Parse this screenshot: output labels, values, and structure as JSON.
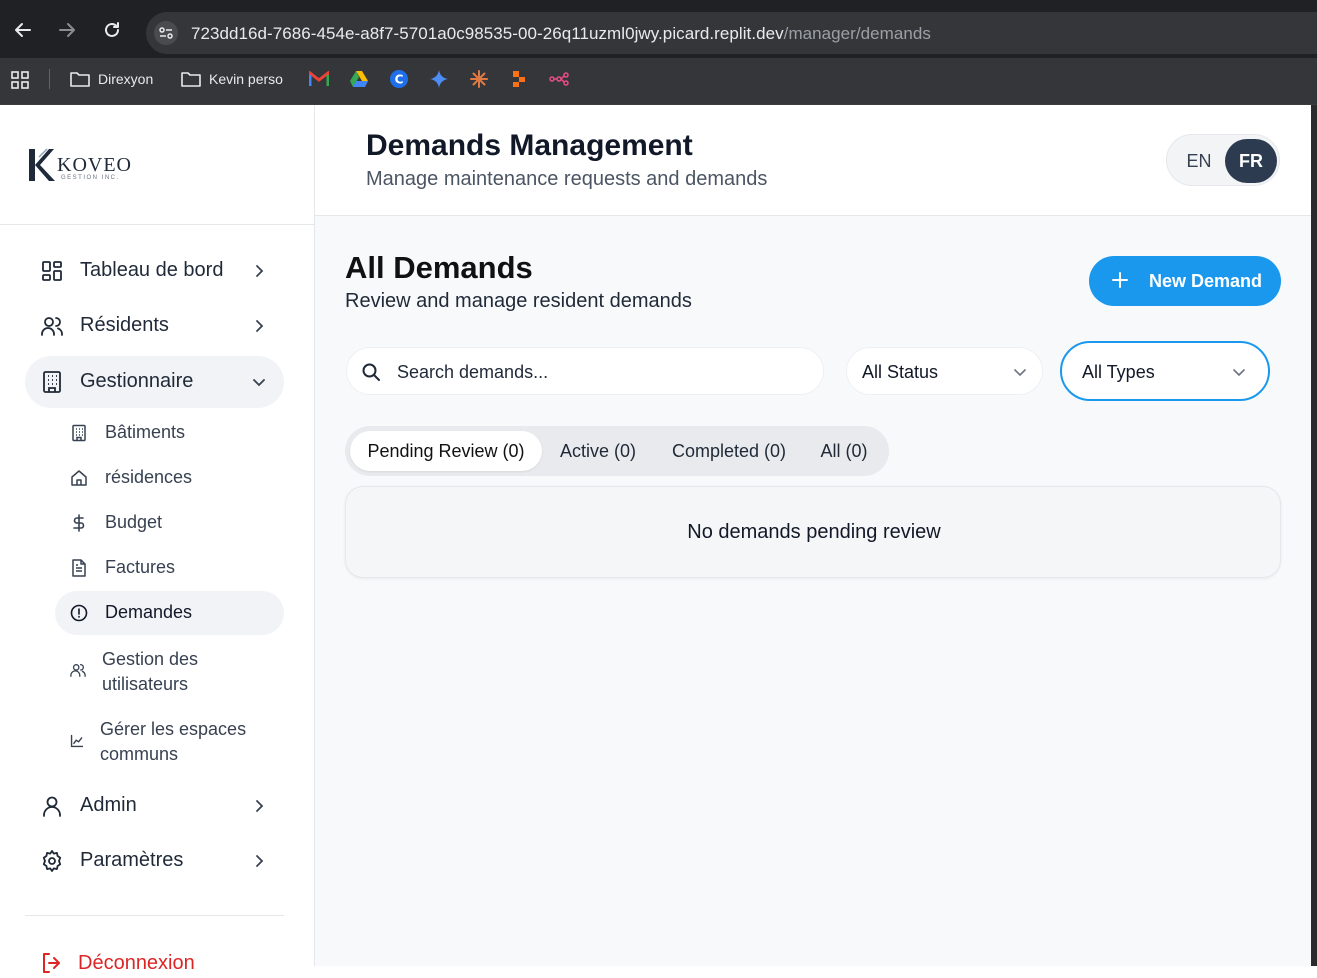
{
  "browser": {
    "url_host": "723dd16d-7686-454e-a8f7-5701a0c98535-00-26q11uzml0jwy.picard.replit.dev",
    "url_path": "/manager/demands",
    "bookmarks": [
      {
        "label": "Direxyon"
      },
      {
        "label": "Kevin perso"
      }
    ]
  },
  "logo": {
    "name": "KOVEO",
    "sub": "GESTION INC."
  },
  "sidebar": {
    "items": [
      {
        "label": "Tableau de bord"
      },
      {
        "label": "Résidents"
      },
      {
        "label": "Gestionnaire"
      },
      {
        "label": "Admin"
      },
      {
        "label": "Paramètres"
      }
    ],
    "subitems": [
      {
        "label": "Bâtiments"
      },
      {
        "label": "résidences"
      },
      {
        "label": "Budget"
      },
      {
        "label": "Factures"
      },
      {
        "label": "Demandes"
      },
      {
        "label_line1": "Gestion des",
        "label_line2": "utilisateurs"
      },
      {
        "label_line1": "Gérer les espaces",
        "label_line2": "communs"
      }
    ],
    "logout": "Déconnexion"
  },
  "header": {
    "title": "Demands Management",
    "subtitle": "Manage maintenance requests and demands",
    "lang_en": "EN",
    "lang_fr": "FR"
  },
  "main": {
    "title": "All Demands",
    "subtitle": "Review and manage resident demands",
    "new_button": "New Demand",
    "search_placeholder": "Search demands...",
    "status_select": "All Status",
    "type_select": "All Types",
    "tabs": [
      {
        "label": "Pending Review (0)"
      },
      {
        "label": "Active (0)"
      },
      {
        "label": "Completed (0)"
      },
      {
        "label": "All (0)"
      }
    ],
    "empty_message": "No demands pending review"
  },
  "colors": {
    "accent": "#1a98ee",
    "danger": "#dc2626",
    "lang_active": "#2d3b50"
  }
}
